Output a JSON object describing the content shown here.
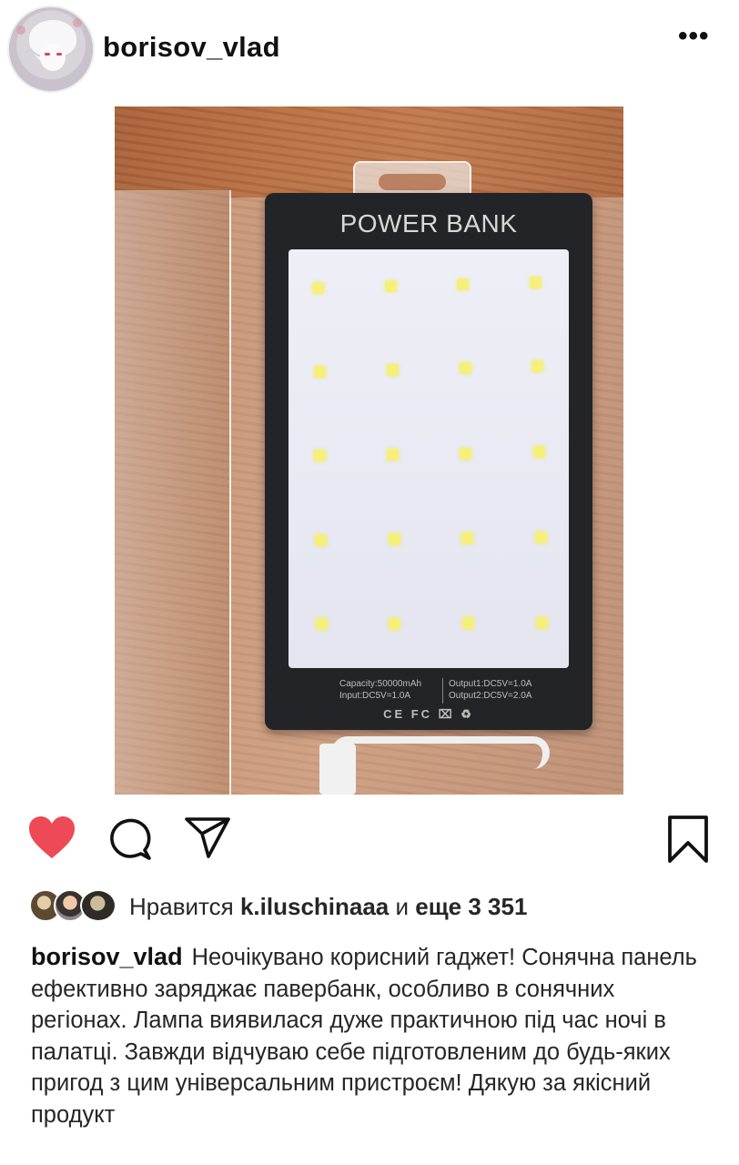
{
  "post": {
    "username": "borisov_vlad",
    "more_label": "•••"
  },
  "photo": {
    "brand_text": "POWER BANK",
    "spec_left_1": "Capacity:50000mAh",
    "spec_left_2": "Input:DC5V=1.0A",
    "spec_right_1": "Output1:DC5V=1.0A",
    "spec_right_2": "Output2:DC5V=2.0A",
    "cert_marks": "CE FC ⌧ ♻"
  },
  "actions": {
    "liked": true,
    "heart_color": "#ed4956"
  },
  "likes": {
    "prefix": "Нравится",
    "user": "k.iluschinaaa",
    "joiner": "и",
    "others": "еще 3 351"
  },
  "caption": {
    "author": "borisov_vlad",
    "text": "Неочікувано корисний гаджет! Сонячна панель ефективно заряджає павербанк, особливо в сонячних регіонах. Лампа виявилася дуже практичною під час ночі в палатці. Завжди відчуваю себе підготовленим до будь-яких пригод з цим універсальним пристроєм! Дякую за якісний продукт"
  }
}
